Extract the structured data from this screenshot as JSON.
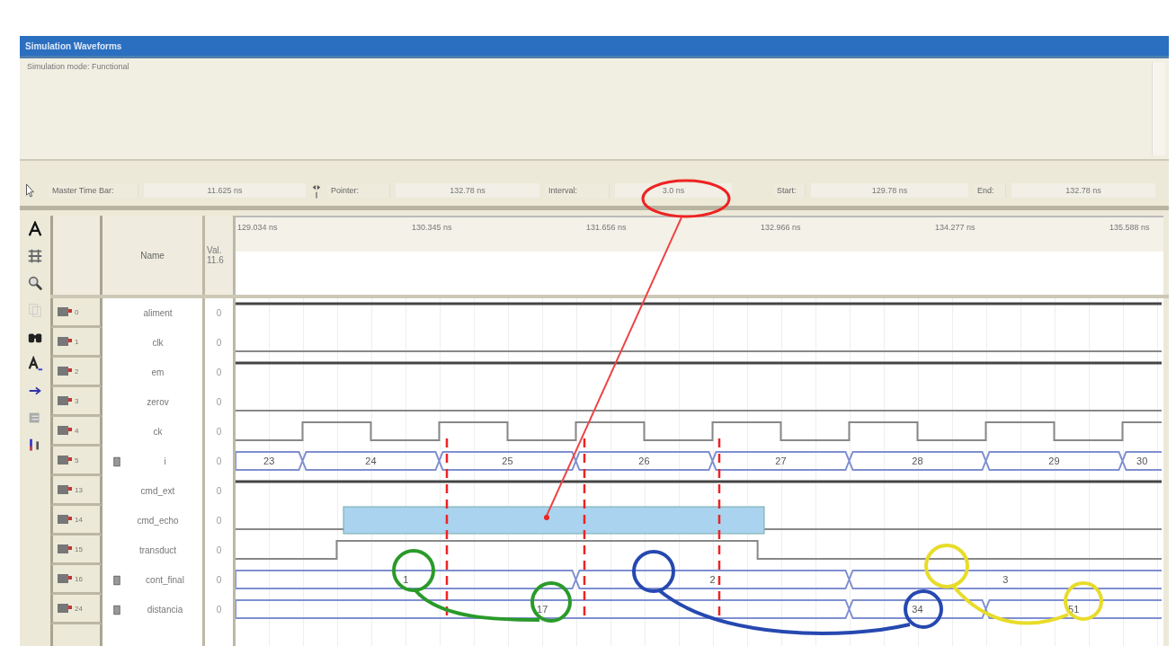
{
  "window": {
    "title": "Simulation Waveforms"
  },
  "message": "Simulation mode: Functional",
  "toolbar": {
    "master_label": "Master Time Bar:",
    "master_value": "11.625 ns",
    "pointer_label": "Pointer:",
    "pointer_value": "132.78 ns",
    "interval_label": "Interval:",
    "interval_value": "3.0 ns",
    "start_label": "Start:",
    "start_value": "129.78 ns",
    "end_label": "End:",
    "end_value": "132.78 ns"
  },
  "table": {
    "name_header": "Name",
    "value_header": [
      "Val.",
      "11.6"
    ],
    "ticks": [
      "129.034 ns",
      "130.345 ns",
      "131.656 ns",
      "132.966 ns",
      "134.277 ns",
      "135.588 ns"
    ],
    "signals": [
      {
        "index": "0",
        "name": "aliment",
        "value": "0",
        "kind": "high"
      },
      {
        "index": "1",
        "name": "clk",
        "value": "0",
        "kind": "low"
      },
      {
        "index": "2",
        "name": "em",
        "value": "0",
        "kind": "high"
      },
      {
        "index": "3",
        "name": "zerov",
        "value": "0",
        "kind": "low"
      },
      {
        "index": "4",
        "name": "ck",
        "value": "0",
        "kind": "clock"
      },
      {
        "index": "5",
        "name": "i",
        "value": "0",
        "kind": "bus",
        "segments": [
          "23",
          "24",
          "25",
          "26",
          "27",
          "28",
          "29",
          "30"
        ]
      },
      {
        "index": "13",
        "name": "cmd_ext",
        "value": "0",
        "kind": "high"
      },
      {
        "index": "14",
        "name": "cmd_echo",
        "value": "0",
        "kind": "low"
      },
      {
        "index": "15",
        "name": "transduct",
        "value": "0",
        "kind": "pulse"
      },
      {
        "index": "16",
        "name": "cont_final",
        "value": "0",
        "kind": "bus",
        "segments": [
          "1",
          "2",
          "3"
        ]
      },
      {
        "index": "24",
        "name": "distancia",
        "value": "0",
        "kind": "bus",
        "segments": [
          "17",
          "34",
          "51"
        ]
      }
    ]
  }
}
